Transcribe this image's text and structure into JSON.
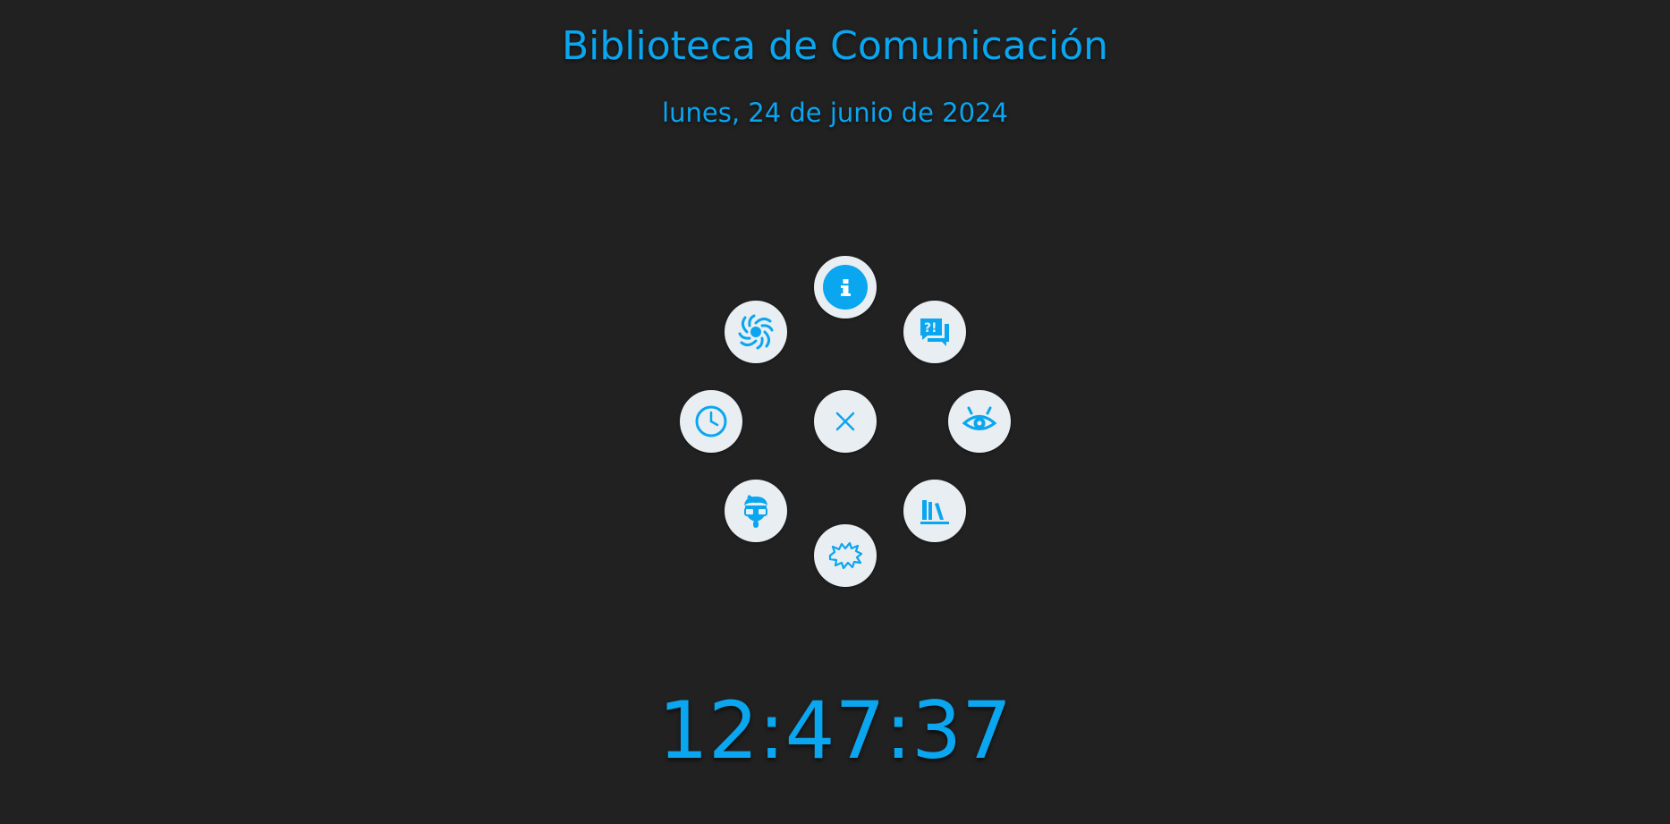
{
  "header": {
    "title": "Biblioteca de Comunicación",
    "date": "lunes, 24 de junio de 2024"
  },
  "clock": {
    "time": "12:47:37"
  },
  "theme": {
    "background": "#212121",
    "accent": "#0aa6f0",
    "button_background": "#e9eef2"
  },
  "radial_menu": {
    "center": {
      "icon": "close-icon"
    },
    "items": [
      {
        "icon": "info-icon",
        "active": true
      },
      {
        "icon": "question-chat-icon"
      },
      {
        "icon": "eye-icon"
      },
      {
        "icon": "bookshelf-icon"
      },
      {
        "icon": "explosion-icon"
      },
      {
        "icon": "nerd-face-icon"
      },
      {
        "icon": "clock-icon"
      },
      {
        "icon": "spiral-icon"
      }
    ]
  }
}
